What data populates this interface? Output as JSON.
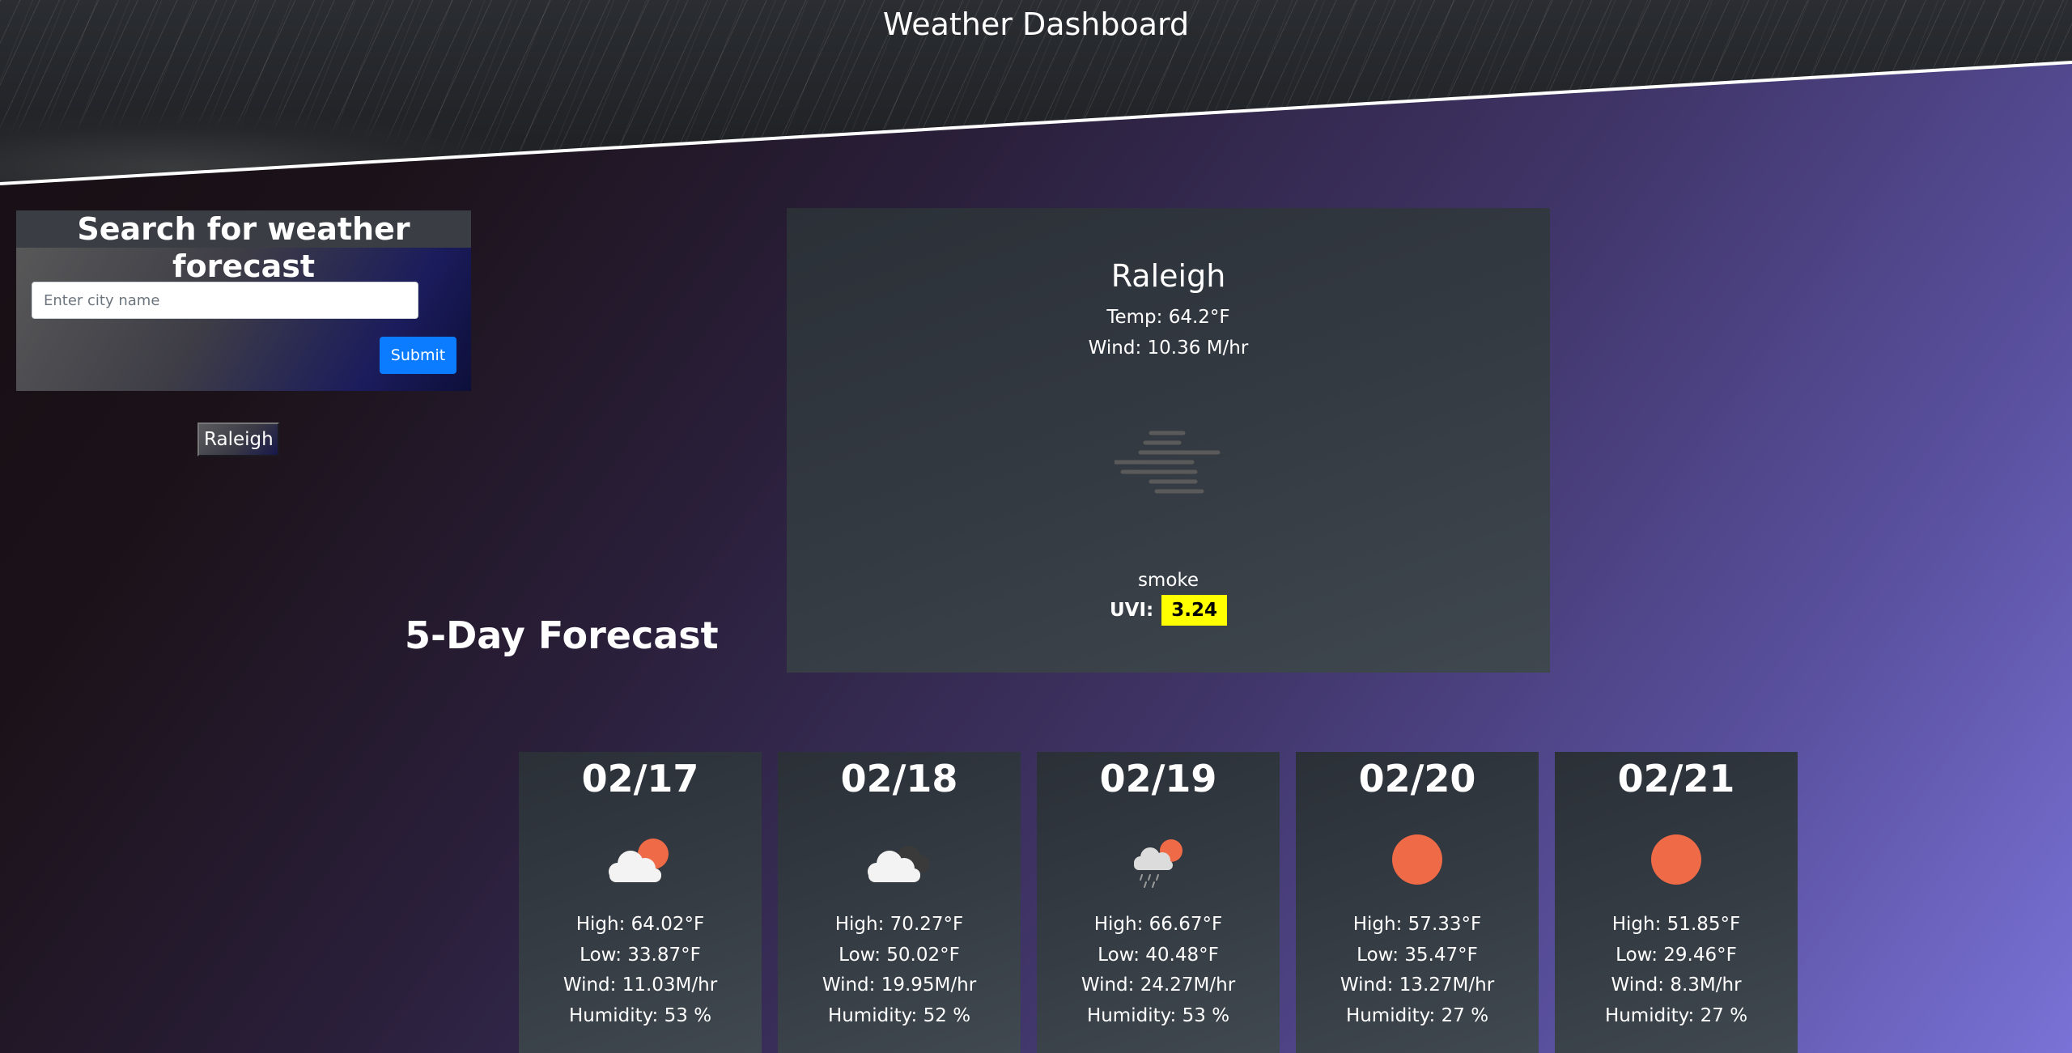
{
  "header": {
    "title": "Weather Dashboard"
  },
  "search": {
    "title": "Search for weather forecast",
    "placeholder": "Enter city name",
    "value": "",
    "submit_label": "Submit"
  },
  "history": [
    {
      "label": "Raleigh"
    }
  ],
  "current": {
    "city": "Raleigh",
    "temp": "Temp: 64.2°F",
    "wind": "Wind: 10.36 M/hr",
    "icon": "haze-icon",
    "description": "smoke",
    "uvi_label": "UVI:",
    "uvi_value": "3.24",
    "uvi_color": "#ffff00"
  },
  "forecast": {
    "title": "5-Day Forecast",
    "days": [
      {
        "date": "02/17",
        "icon": "partly-cloudy-icon",
        "high": "High: 64.02°F",
        "low": "Low: 33.87°F",
        "wind": "Wind: 11.03M/hr",
        "humidity": "Humidity: 53 %"
      },
      {
        "date": "02/18",
        "icon": "cloudy-icon",
        "high": "High: 70.27°F",
        "low": "Low: 50.02°F",
        "wind": "Wind: 19.95M/hr",
        "humidity": "Humidity: 52 %"
      },
      {
        "date": "02/19",
        "icon": "rain-icon",
        "high": "High: 66.67°F",
        "low": "Low: 40.48°F",
        "wind": "Wind: 24.27M/hr",
        "humidity": "Humidity: 53 %"
      },
      {
        "date": "02/20",
        "icon": "sun-icon",
        "high": "High: 57.33°F",
        "low": "Low: 35.47°F",
        "wind": "Wind: 13.27M/hr",
        "humidity": "Humidity: 27 %"
      },
      {
        "date": "02/21",
        "icon": "sun-icon",
        "high": "High: 51.85°F",
        "low": "Low: 29.46°F",
        "wind": "Wind: 8.3M/hr",
        "humidity": "Humidity: 27 %"
      }
    ]
  },
  "colors": {
    "sun": "#ef6a47",
    "accent_button": "#0b7bff",
    "uvi_badge": "#ffff00"
  }
}
